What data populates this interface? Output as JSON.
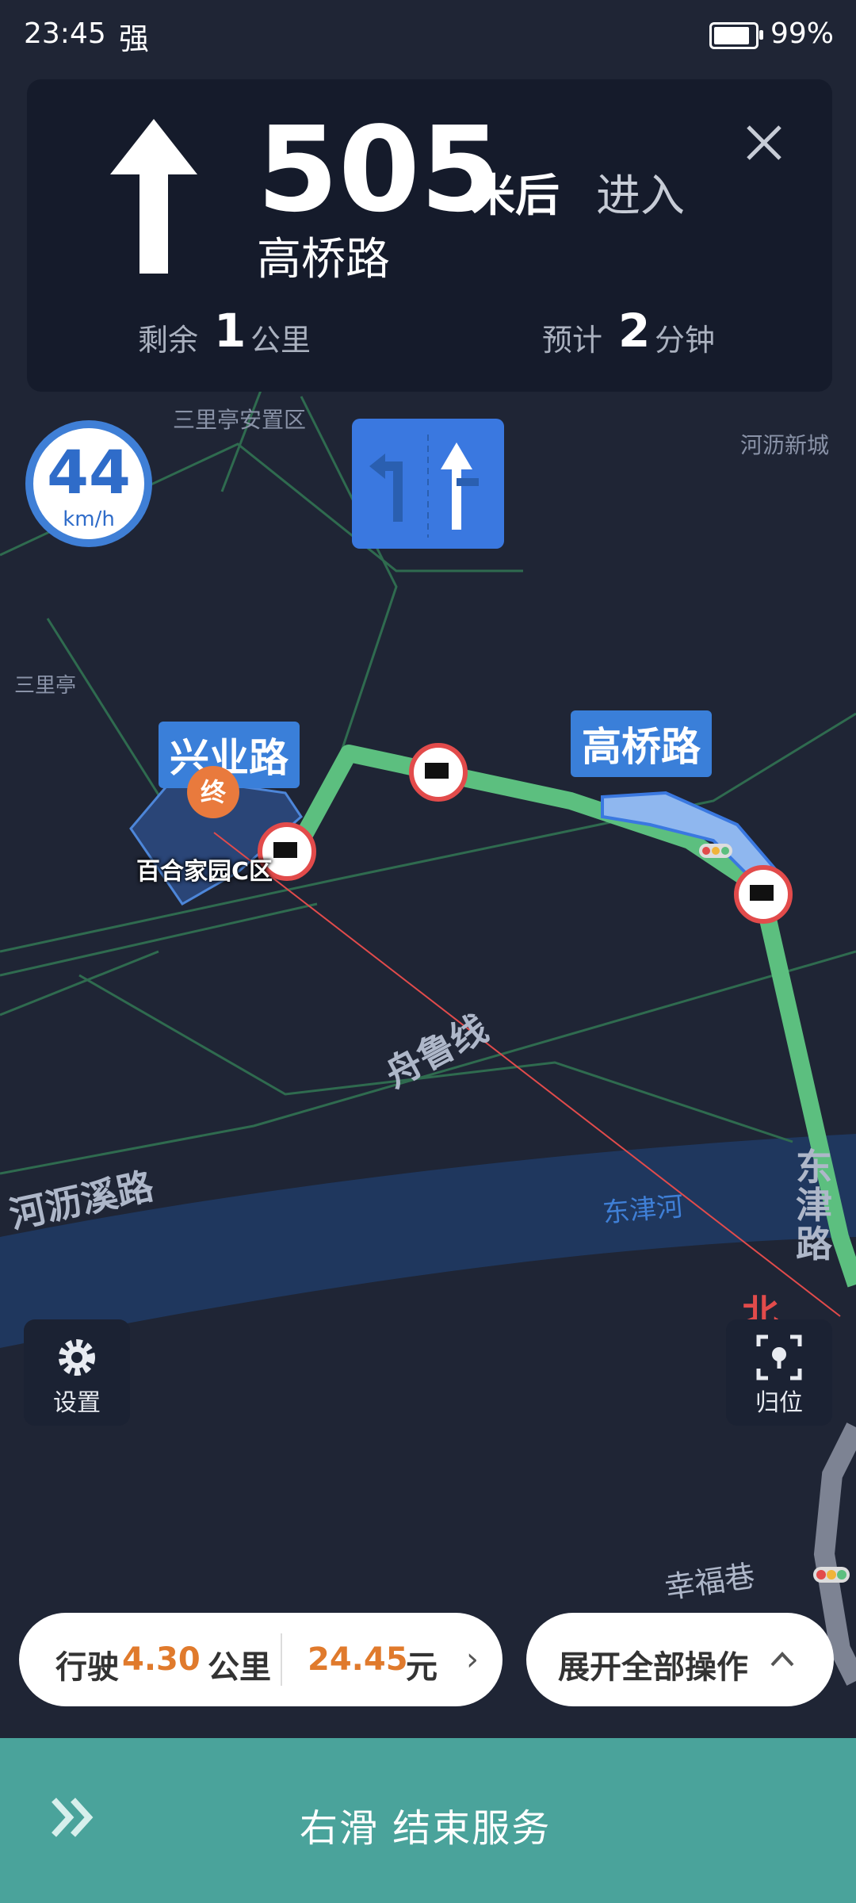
{
  "status_bar": {
    "time": "23:45",
    "signal": "强",
    "battery": "99%",
    "battery_level": 0.99
  },
  "nav": {
    "distance": "505",
    "distance_unit": "米后",
    "action": "进入",
    "road": "高桥路",
    "remaining_label": "剩余",
    "remaining_value": "1",
    "remaining_unit": "公里",
    "eta_label": "预计",
    "eta_value": "2",
    "eta_unit": "分钟"
  },
  "speed": {
    "value": "44",
    "unit": "km/h"
  },
  "map": {
    "labels": {
      "sanli_anzhi": "三里亭安置区",
      "helishi_xincheng": "河沥新城",
      "sanliting": "三里亭",
      "zhoulu_line": "舟鲁线",
      "helixi_road": "河沥溪路",
      "dongjin_river": "东津河",
      "dongjin_road": "东津路",
      "xingfu_lane": "幸福巷"
    },
    "callouts": {
      "xingye_road": "兴业路",
      "gaoqiao_road": "高桥路"
    },
    "end_marker": "终",
    "poi": "百合家园C区",
    "north": "北"
  },
  "buttons": {
    "settings": "设置",
    "locate": "归位"
  },
  "trip": {
    "prefix": "行驶",
    "distance": "4.30",
    "distance_unit": "公里",
    "price": "24.45",
    "currency": "元"
  },
  "ops": {
    "label": "展开全部操作"
  },
  "slide": {
    "text": "右滑   结束服务"
  },
  "colors": {
    "route": "#5cbf7f",
    "accent": "#3a7fd9",
    "price": "#e07a2c",
    "slide_bar": "#4aa39b"
  }
}
